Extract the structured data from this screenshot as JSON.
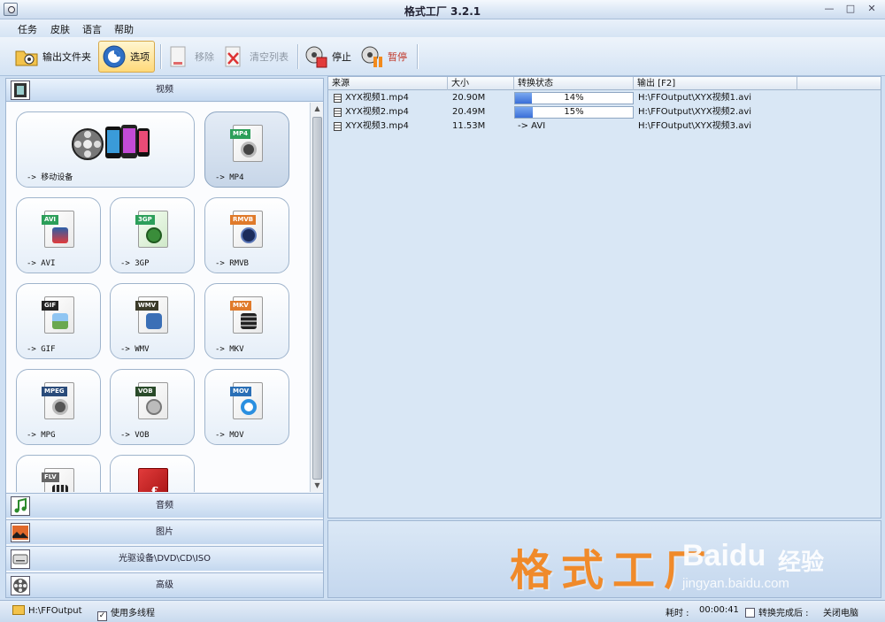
{
  "window": {
    "title": "格式工厂 3.2.1"
  },
  "menu": [
    "任务",
    "皮肤",
    "语言",
    "帮助"
  ],
  "toolbar": {
    "output_folder": "输出文件夹",
    "options": "选项",
    "remove": "移除",
    "clear_list": "清空列表",
    "stop": "停止",
    "pause": "暂停"
  },
  "left_panel": {
    "video_category": "视频",
    "tiles": [
      {
        "label": "-> 移动设备"
      },
      {
        "label": "-> MP4",
        "tag": "MP4"
      },
      {
        "label": "-> AVI",
        "tag": "AVI"
      },
      {
        "label": "-> 3GP",
        "tag": "3GP"
      },
      {
        "label": "-> RMVB",
        "tag": "RMVB"
      },
      {
        "label": "-> GIF",
        "tag": "GIF"
      },
      {
        "label": "-> WMV",
        "tag": "WMV"
      },
      {
        "label": "-> MKV",
        "tag": "MKV"
      },
      {
        "label": "-> MPG",
        "tag": "MPEG"
      },
      {
        "label": "-> VOB",
        "tag": "VOB"
      },
      {
        "label": "-> MOV",
        "tag": "MOV"
      },
      {
        "label": "",
        "tag": "FLV"
      },
      {
        "label": "",
        "tag": ""
      }
    ],
    "categories": [
      "音频",
      "图片",
      "光驱设备\\DVD\\CD\\ISO",
      "高级"
    ]
  },
  "file_table": {
    "columns": [
      "来源",
      "大小",
      "转换状态",
      "输出 [F2]"
    ],
    "rows": [
      {
        "source": "XYX视频1.mp4",
        "size": "20.90M",
        "status": "14%",
        "progress": 14,
        "output": "H:\\FFOutput\\XYX视频1.avi"
      },
      {
        "source": "XYX视频2.mp4",
        "size": "20.49M",
        "status": "15%",
        "progress": 15,
        "output": "H:\\FFOutput\\XYX视频2.avi"
      },
      {
        "source": "XYX视频3.mp4",
        "size": "11.53M",
        "status": "-> AVI",
        "progress": null,
        "output": "H:\\FFOutput\\XYX视频3.avi"
      }
    ]
  },
  "logo": {
    "app_name": "格式工厂",
    "watermark_brand": "Baidu",
    "watermark_suffix": "经验",
    "watermark_url": "jingyan.baidu.com"
  },
  "status_bar": {
    "output_path": "H:\\FFOutput",
    "multithread": "使用多线程",
    "elapsed_label": "耗时 :",
    "elapsed_value": "00:00:41",
    "after_convert": "转换完成后 :",
    "after_action": "关闭电脑"
  },
  "colors": {
    "accent_orange": "#f08a2a",
    "progress_blue": "#3a6fd8",
    "panel_blue": "#d9e7f5"
  }
}
